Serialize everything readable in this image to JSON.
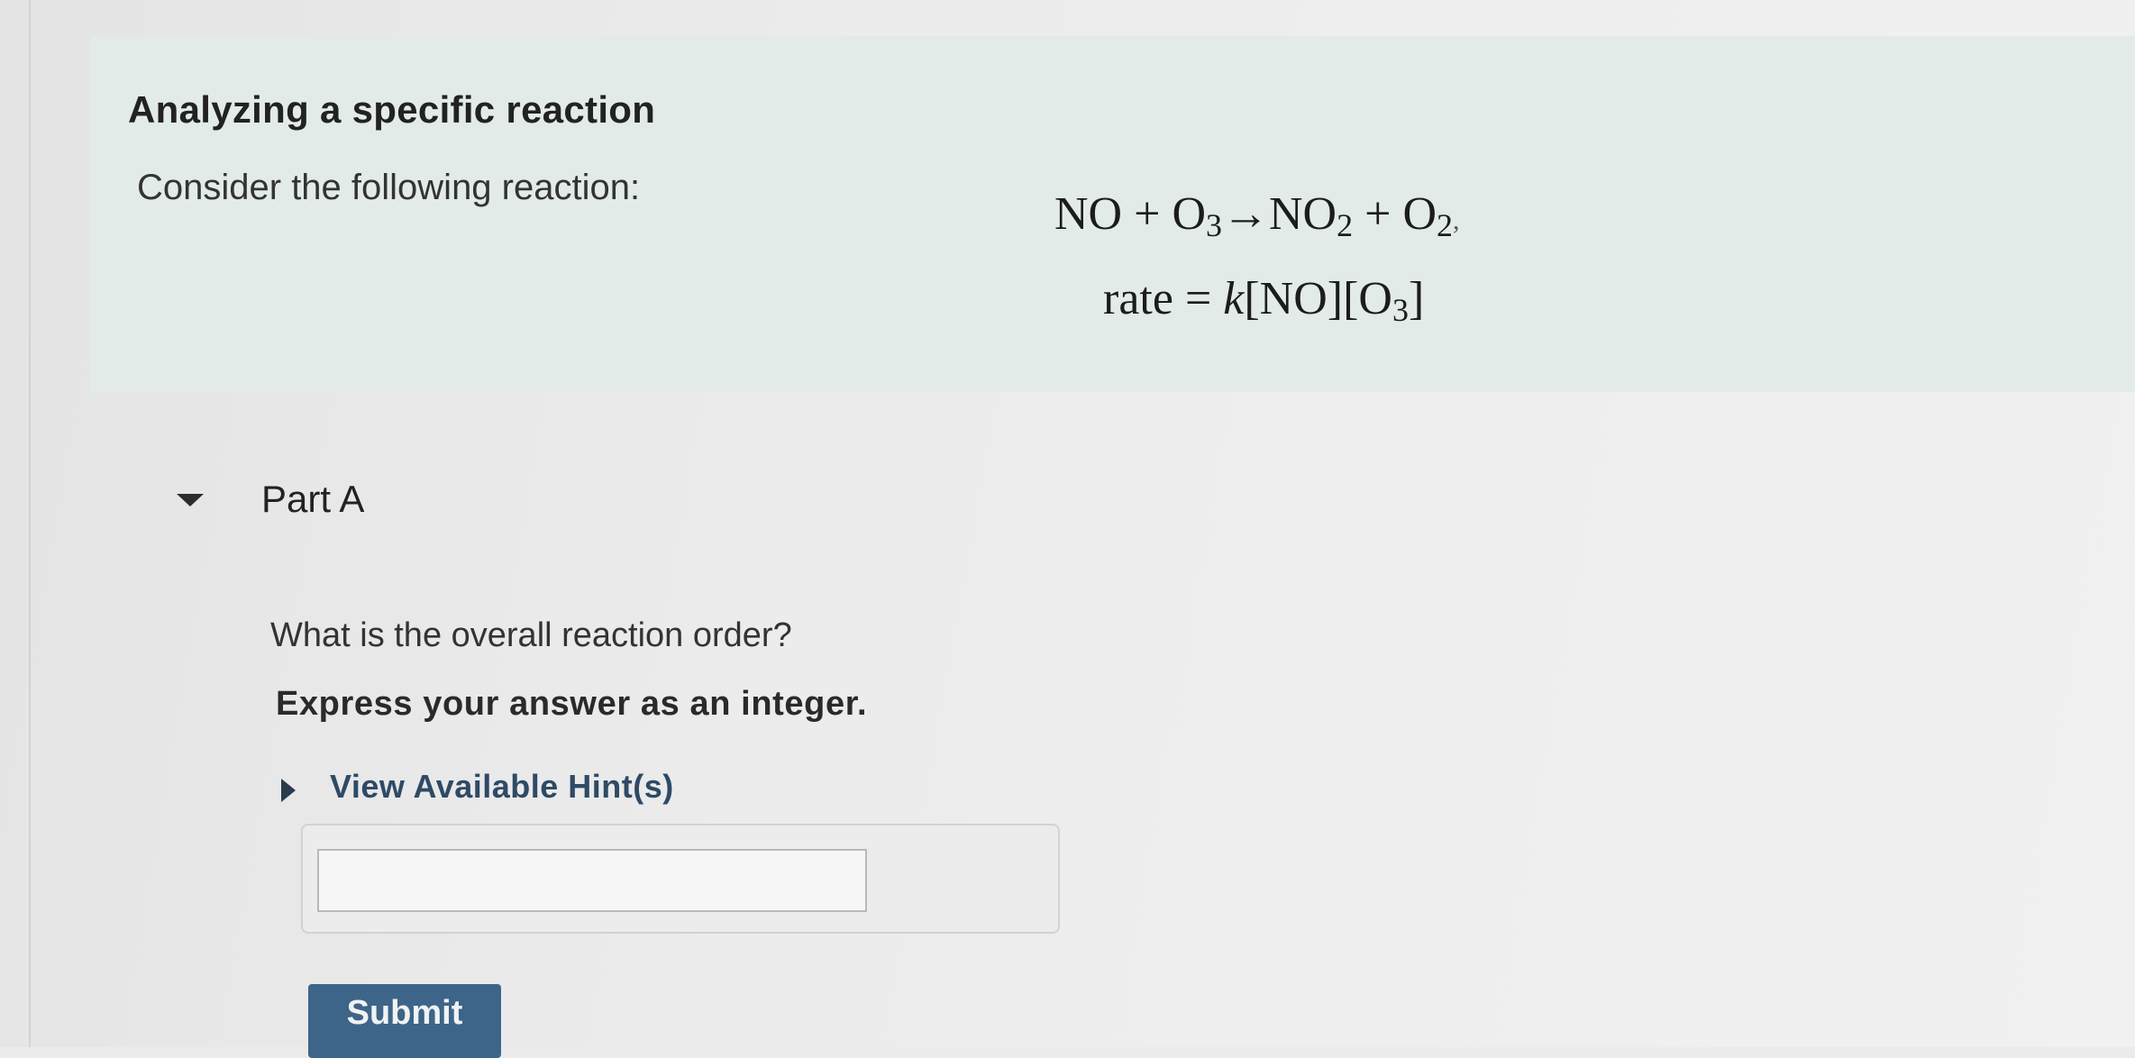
{
  "intro": {
    "title": "Analyzing a specific reaction",
    "text": "Consider the following reaction:"
  },
  "equations": {
    "reaction": {
      "r1": "NO",
      "plus1": " + ",
      "r2": "O",
      "r2_sub": "3",
      "arrow": "→",
      "p1": "NO",
      "p1_sub": "2",
      "plus2": " + ",
      "p2": "O",
      "p2_sub": "2",
      "end": ","
    },
    "rate_law": {
      "lhs": "rate",
      "eq": " = ",
      "k": "k",
      "b1": "[NO]",
      "b2_open": "[O",
      "b2_sub": "3",
      "b2_close": "]"
    }
  },
  "part": {
    "title": "Part A",
    "question": "What is the overall reaction order?",
    "instruction": "Express your answer as an integer.",
    "hint_label": "View Available Hint(s)",
    "answer_value": "",
    "submit_label": "Submit"
  },
  "colors": {
    "intro_bg": "#e3ebe9",
    "link": "#2e4a66",
    "submit_bg": "#3c6589"
  },
  "icons": {
    "part_toggle": "triangle-down-icon",
    "hint_toggle": "triangle-right-icon"
  }
}
